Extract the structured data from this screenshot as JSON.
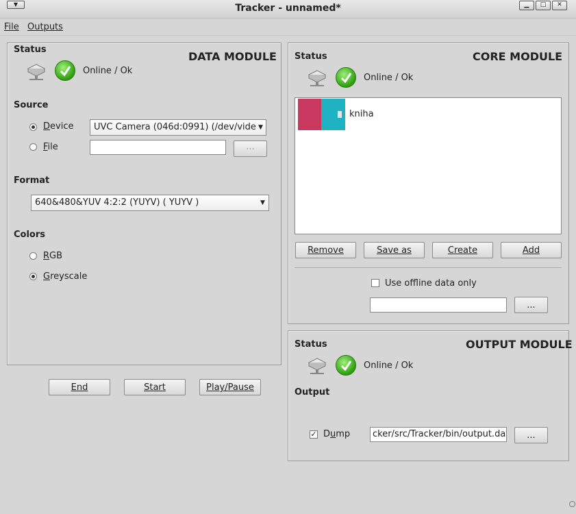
{
  "window": {
    "title": "Tracker - unnamed*"
  },
  "menu": {
    "file": "File",
    "outputs": "Outputs"
  },
  "data_module": {
    "title": "DATA MODULE",
    "status_label": "Status",
    "status_text": "Online / Ok",
    "source_label": "Source",
    "device_label": "Device",
    "device_value": "UVC Camera (046d:0991) (/dev/vide",
    "file_label": "File",
    "file_value": "",
    "file_browse": "...",
    "format_label": "Format",
    "format_value": "640&480&YUV 4:2:2 (YUYV) ( YUYV )",
    "colors_label": "Colors",
    "rgb_label": "RGB",
    "greyscale_label": "Greyscale",
    "selected_source": "Device",
    "selected_color": "Greyscale"
  },
  "core_module": {
    "title": "CORE MODULE",
    "status_label": "Status",
    "status_text": "Online / Ok",
    "items": [
      {
        "label": "kniha"
      }
    ],
    "remove": "Remove",
    "save_as": "Save as",
    "create": "Create",
    "add": "Add",
    "offline_label": "Use offline data only",
    "offline_checked": false,
    "offline_path": "",
    "offline_browse": "..."
  },
  "output_module": {
    "title": "OUTPUT MODULE",
    "status_label": "Status",
    "status_text": "Online / Ok",
    "output_label": "Output",
    "dump_label": "Dump",
    "dump_checked": true,
    "dump_path": "cker/src/Tracker/bin/output.dat",
    "browse": "..."
  },
  "controls": {
    "end": "End",
    "start": "Start",
    "play_pause": "Play/Pause"
  },
  "icons": [
    "window-menu-icon",
    "minimize-icon",
    "maximize-icon",
    "close-icon",
    "network-drive-icon",
    "ok-check-icon",
    "resize-grip-icon"
  ],
  "colors": {
    "ok_green": "#2e9e10",
    "thumb_pink": "#c8385f",
    "thumb_teal": "#1fb2c2"
  }
}
